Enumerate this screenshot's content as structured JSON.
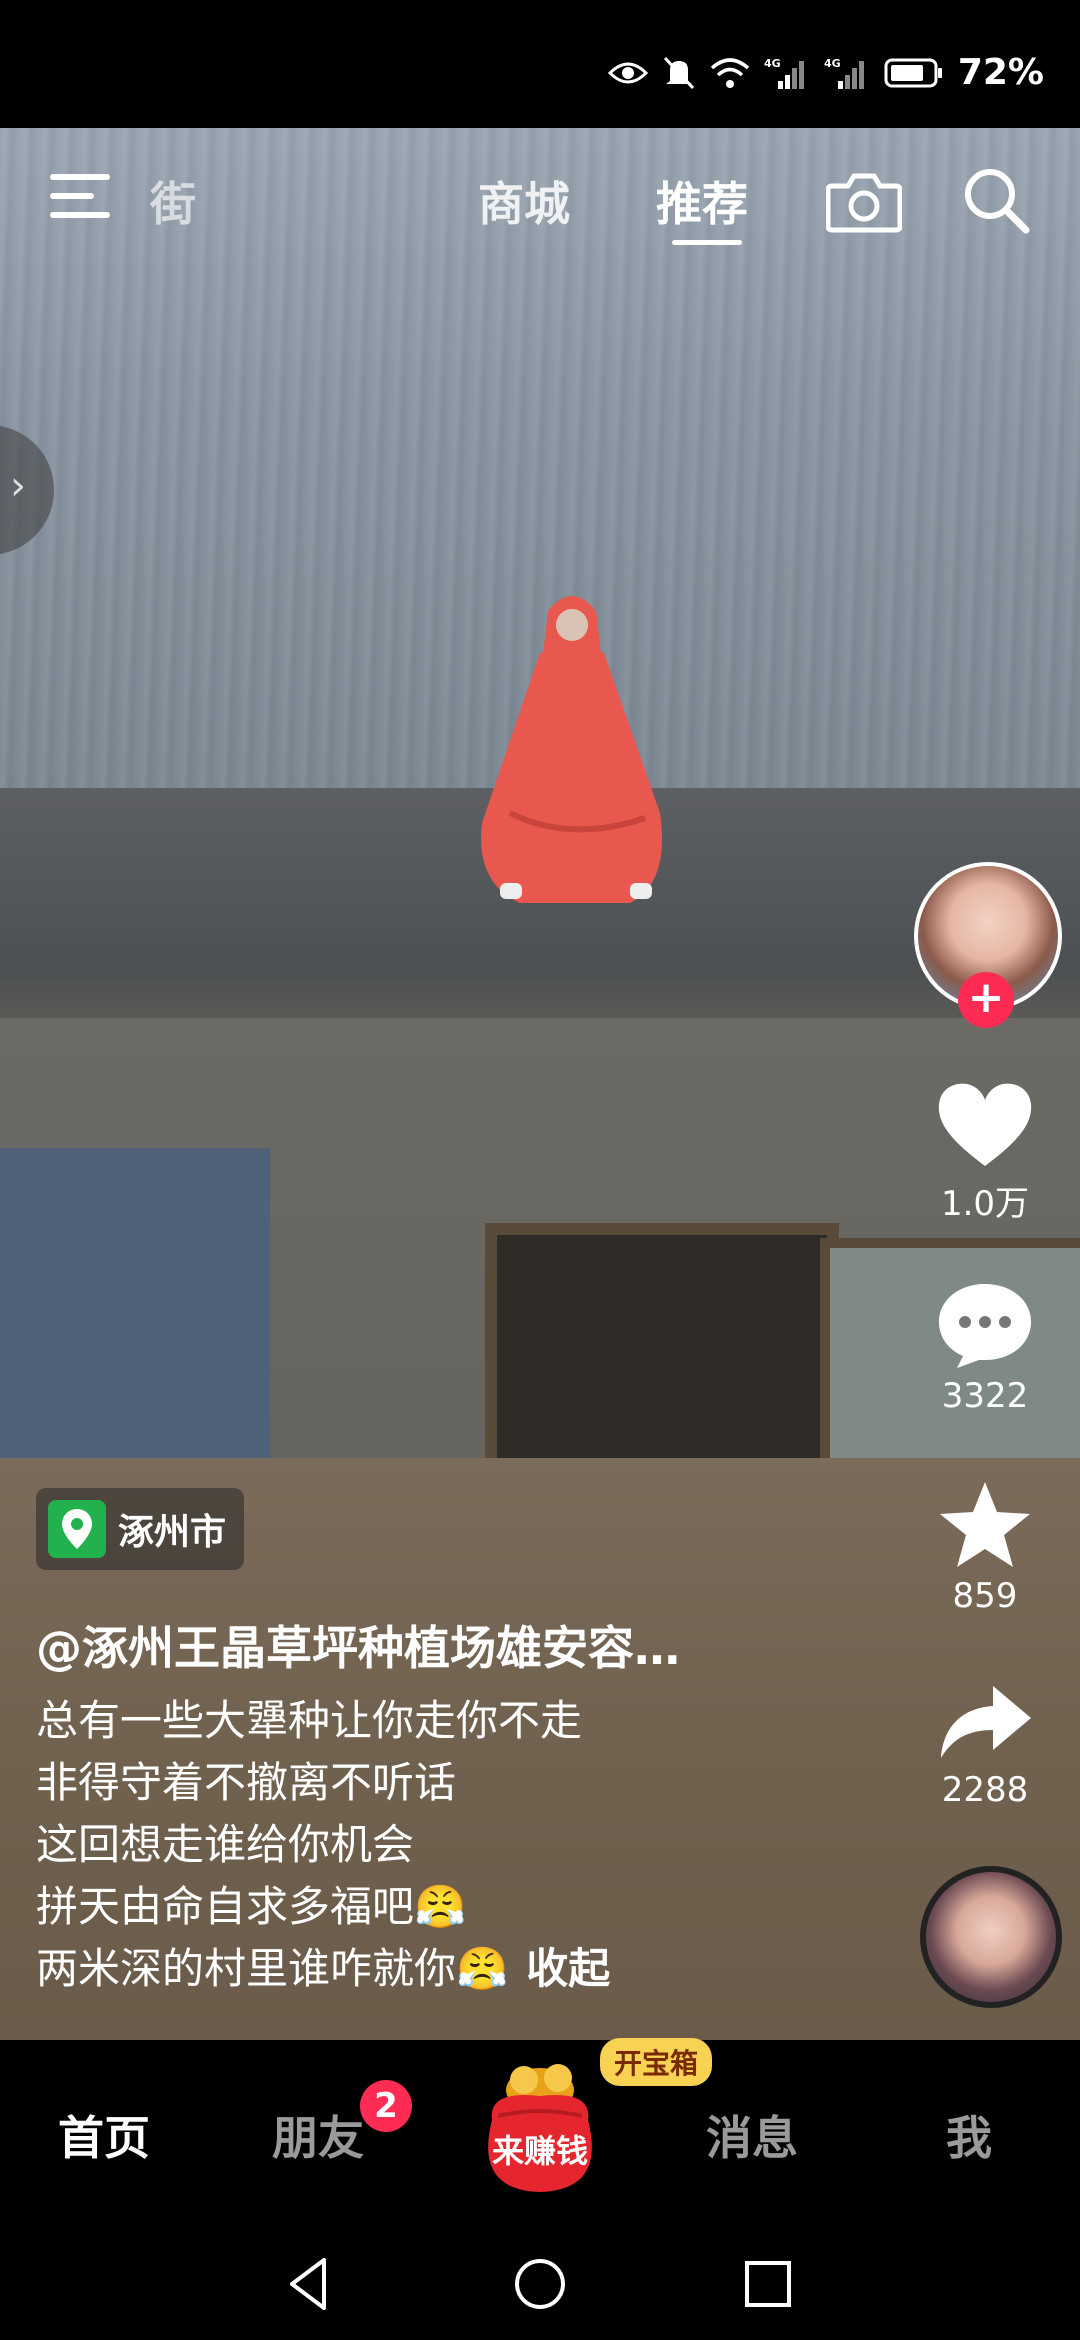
{
  "status_bar": {
    "battery_percent": "72%",
    "network_1": "4G",
    "network_2": "4G",
    "icons": [
      "eye-icon",
      "mute-icon",
      "wifi-icon",
      "signal-icon",
      "signal-icon",
      "battery-icon"
    ]
  },
  "top_nav": {
    "tabs": [
      {
        "label": "街"
      },
      {
        "label": "商城"
      },
      {
        "label": "推荐",
        "active": true
      }
    ],
    "icons": [
      "menu-icon",
      "camera-icon",
      "search-icon"
    ]
  },
  "side_handle": {
    "glyph": "›"
  },
  "video": {
    "location": "涿州市",
    "author": "@涿州王晶草坪种植场雄安容…",
    "caption_lines": [
      "总有一些大犟种让你走你不走",
      "非得守着不撤离不听话",
      "这回想走谁给你机会",
      "拼天由命自求多福吧😤",
      "两米深的村里谁咋就你😤"
    ],
    "collapse_label": "收起"
  },
  "actions": {
    "follow": "+",
    "likes": "1.0万",
    "comments": "3322",
    "favorites": "859",
    "shares": "2288"
  },
  "bottom_nav": {
    "home": "首页",
    "friends": "朋友",
    "friends_badge": "2",
    "earn": "来赚钱",
    "treasure": "开宝箱",
    "messages": "消息",
    "me": "我"
  },
  "colors": {
    "accent": "#fe2c55",
    "location_pin": "#22b14c",
    "treasure_bg": "#f7d253",
    "raincoat": "#e8584f"
  }
}
